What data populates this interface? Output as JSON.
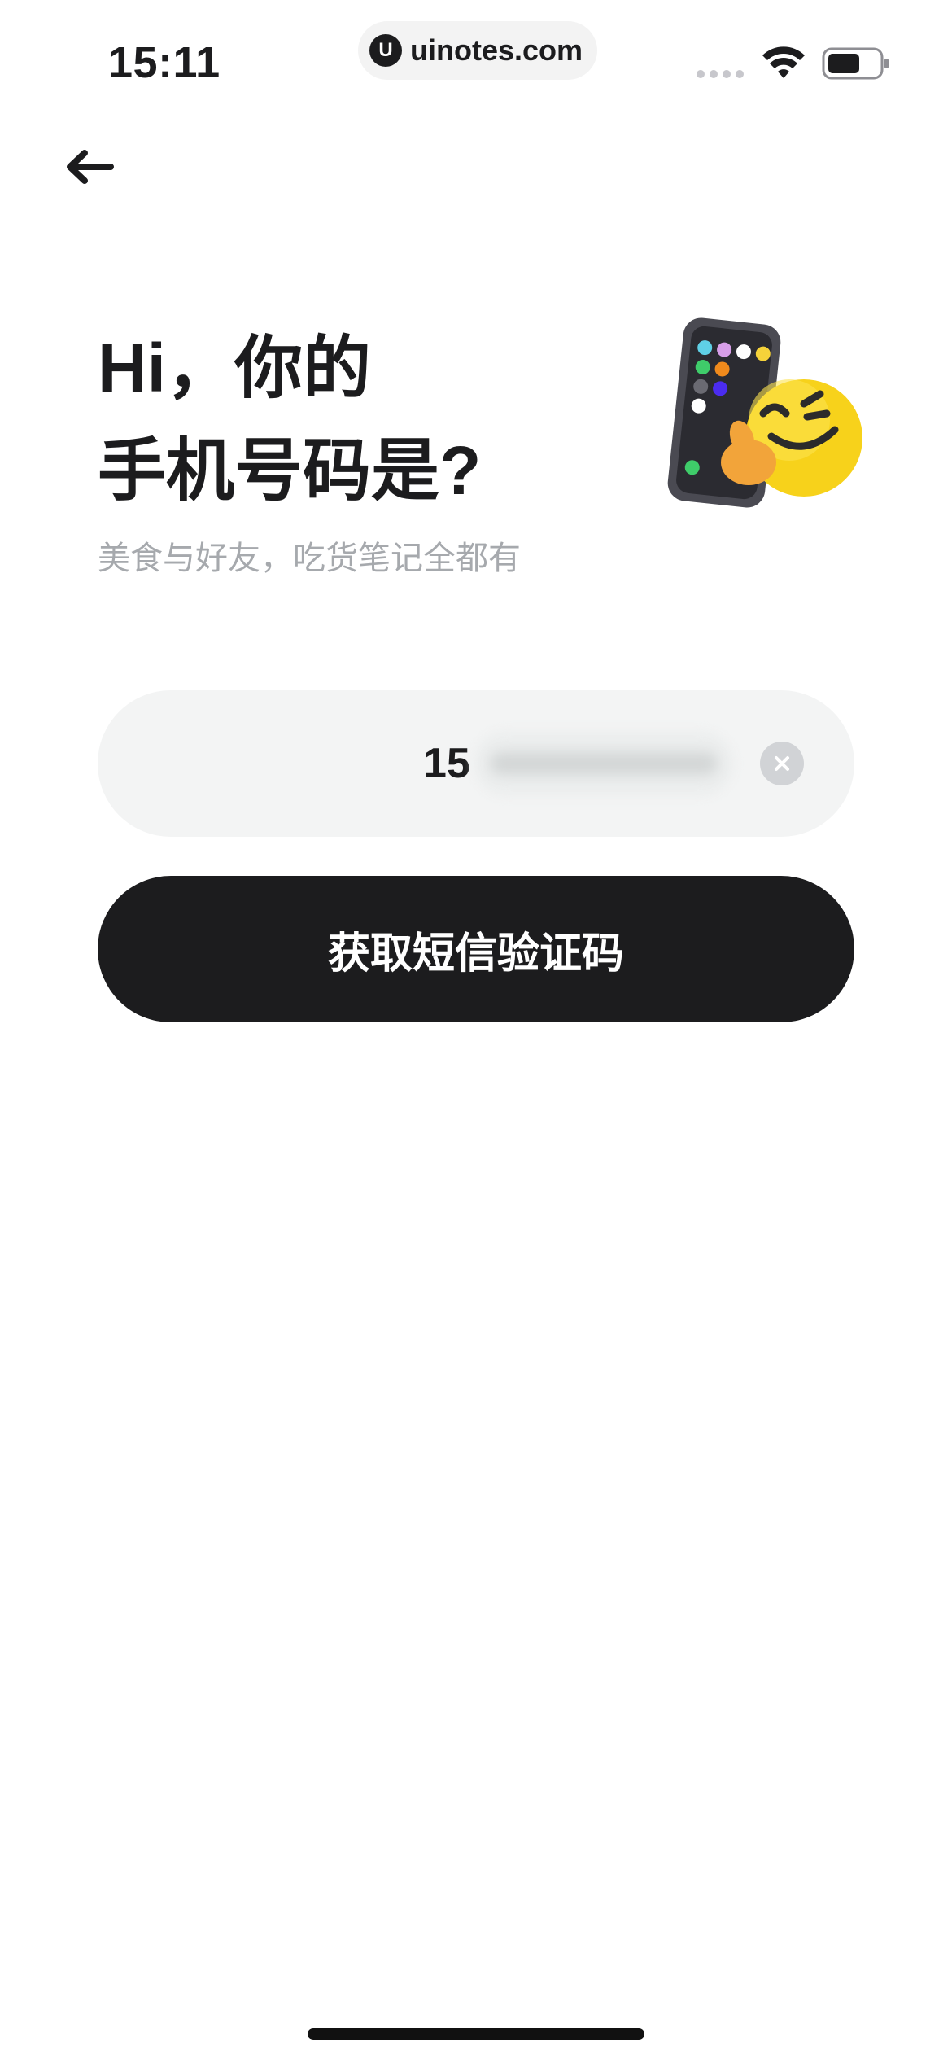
{
  "status_bar": {
    "time": "15:11",
    "url": "uinotes.com",
    "url_logo_letter": "U"
  },
  "header": {
    "back_icon": "arrow-left-icon"
  },
  "title": {
    "line1": "Hi，你的",
    "line2": "手机号码是?",
    "subtitle": "美食与好友，吃货笔记全都有"
  },
  "phone_input": {
    "value_visible": "15",
    "clear_icon": "clear-circle-icon"
  },
  "submit": {
    "label": "获取短信验证码"
  },
  "colors": {
    "primary": "#1c1c1e",
    "input_bg": "#f3f4f4",
    "subtitle": "#a6a9ad",
    "emoji_yellow": "#f7d21b"
  }
}
